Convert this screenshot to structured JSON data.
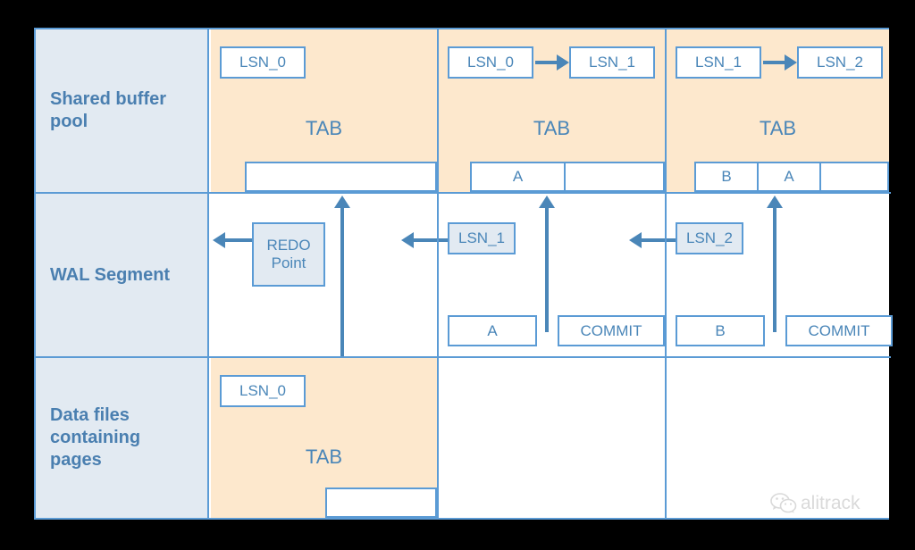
{
  "diagram": {
    "rows": [
      {
        "label": "Shared buffer\npool"
      },
      {
        "label": "WAL Segment"
      },
      {
        "label": "Data files\ncontaining\npages"
      }
    ],
    "buffer_pool": {
      "columns": [
        {
          "lsn_left": "LSN_0",
          "lsn_right": null,
          "arrow": false,
          "tab": "TAB",
          "pages": [
            ""
          ]
        },
        {
          "lsn_left": "LSN_0",
          "lsn_right": "LSN_1",
          "arrow": true,
          "tab": "TAB",
          "pages": [
            "A",
            ""
          ]
        },
        {
          "lsn_left": "LSN_1",
          "lsn_right": "LSN_2",
          "arrow": true,
          "tab": "TAB",
          "pages": [
            "B",
            "A",
            ""
          ]
        }
      ]
    },
    "wal_segment": {
      "columns": [
        {
          "marker": "REDO\nPoint",
          "marker_line1": "REDO",
          "marker_line2": "Point",
          "records": []
        },
        {
          "marker": "LSN_1",
          "records": [
            "A",
            "COMMIT"
          ]
        },
        {
          "marker": "LSN_2",
          "records": [
            "B",
            "COMMIT"
          ]
        }
      ]
    },
    "data_files": {
      "columns": [
        {
          "lsn": "LSN_0",
          "tab": "TAB",
          "pages": [
            ""
          ]
        },
        {
          "lsn": null,
          "tab": null,
          "pages": []
        },
        {
          "lsn": null,
          "tab": null,
          "pages": []
        }
      ]
    },
    "colors": {
      "border": "#5b9bd5",
      "label_bg": "#e2eaf2",
      "tab_bg": "#fde8cd",
      "text": "#4a86b8",
      "label_text": "#4a7fb0"
    }
  },
  "watermark": {
    "text": "alitrack",
    "icon": "wechat-icon"
  }
}
